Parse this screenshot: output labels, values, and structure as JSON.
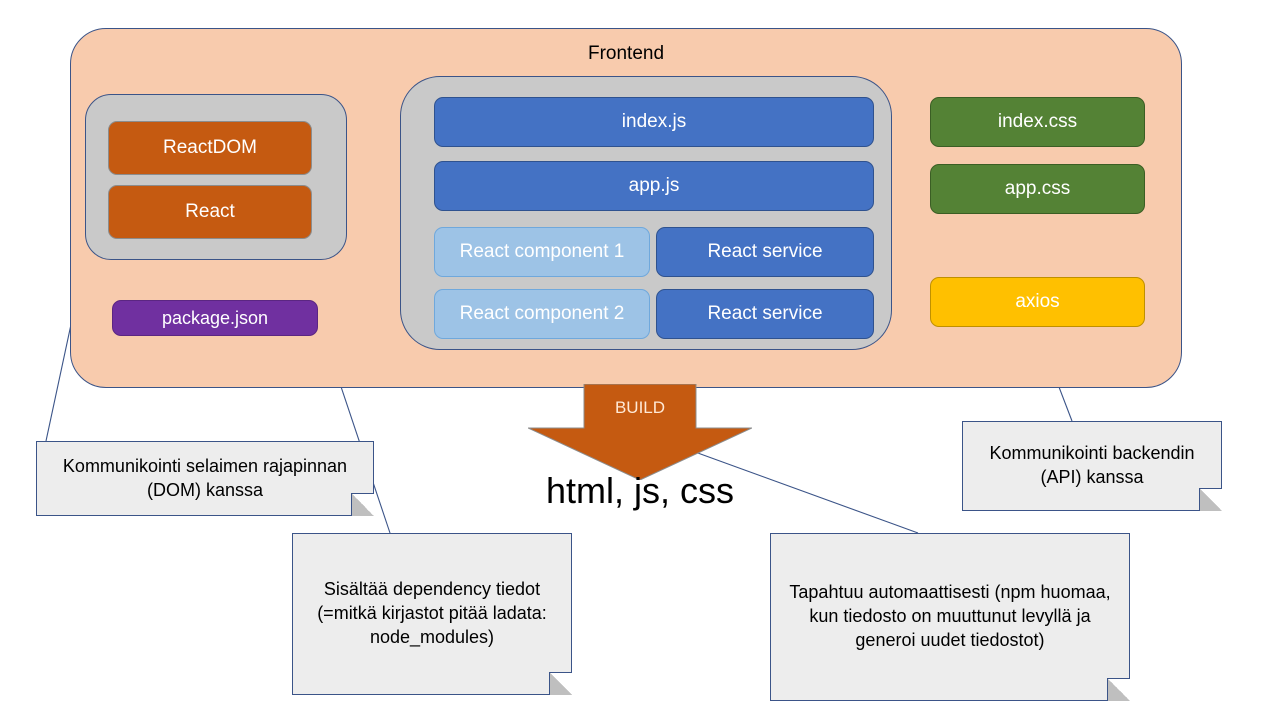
{
  "diagram": {
    "frontend": {
      "title": "Frontend",
      "fill": "#F8CBAD",
      "stroke": "#3B5488"
    },
    "groups": {
      "libraries_label": "react-libraries-group",
      "app_label": "application-sources-group"
    },
    "nodes": {
      "reactdom": {
        "label": "ReactDOM",
        "color": "#C55A11"
      },
      "react": {
        "label": "React",
        "color": "#C55A11"
      },
      "packagejson": {
        "label": "package.json",
        "color": "#7030A0"
      },
      "indexjs": {
        "label": "index.js",
        "color": "#4472C4"
      },
      "appjs": {
        "label": "app.js",
        "color": "#4472C4"
      },
      "component1": {
        "label": "React component 1",
        "color": "#9DC3E6"
      },
      "component2": {
        "label": "React component 2",
        "color": "#9DC3E6"
      },
      "service1": {
        "label": "React service",
        "color": "#4472C4"
      },
      "service2": {
        "label": "React service",
        "color": "#4472C4"
      },
      "indexcss": {
        "label": "index.css",
        "color": "#548235"
      },
      "appcss": {
        "label": "app.css",
        "color": "#548235"
      },
      "axios": {
        "label": "axios",
        "color": "#FFC000"
      }
    },
    "build": {
      "label": "BUILD",
      "output": "html, js, css",
      "color": "#C55A11"
    },
    "notes": {
      "dom": {
        "text": "Kommunikointi selaimen rajapinnan (DOM) kanssa"
      },
      "pkg": {
        "text": "Sisältää dependency tiedot (=mitkä kirjastot pitää ladata: node_modules)"
      },
      "build": {
        "text": "Tapahtuu automaattisesti (npm huomaa, kun tiedosto on muuttunut levyllä ja generoi uudet tiedostot)"
      },
      "api": {
        "text": "Kommunikointi backendin (API) kanssa"
      }
    },
    "connector_color": "#4472C4",
    "leader_color": "#4472C4"
  }
}
